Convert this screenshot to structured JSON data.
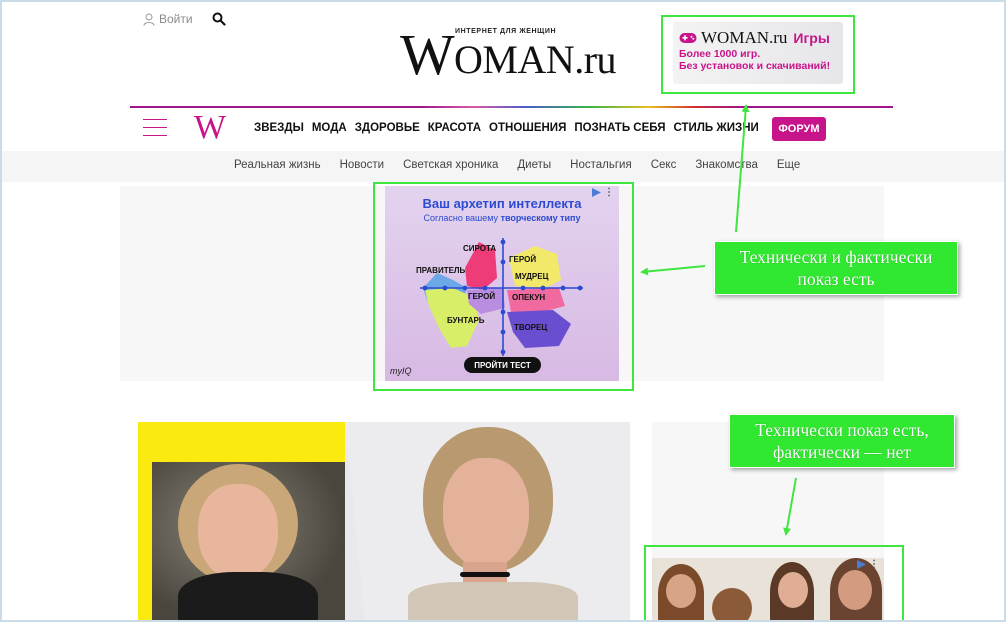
{
  "header": {
    "login_label": "Войти",
    "logo_tagline": "ИНТЕРНЕТ ДЛЯ ЖЕНЩИН",
    "logo_letter": "W",
    "logo_rest": "OMAN.ru"
  },
  "games_banner": {
    "brand": "WOMAN.ru",
    "title": "Игры",
    "line1": "Более 1000 игр.",
    "line2": "Без установок и скачиваний!"
  },
  "nav": {
    "w_mark": "W",
    "items": [
      "ЗВЕЗДЫ",
      "МОДА",
      "ЗДОРОВЬЕ",
      "КРАСОТА",
      "ОТНОШЕНИЯ",
      "ПОЗНАТЬ СЕБЯ",
      "СТИЛЬ ЖИЗНИ"
    ],
    "forum": "ФОРУМ"
  },
  "subnav": {
    "items": [
      "Реальная жизнь",
      "Новости",
      "Светская хроника",
      "Диеты",
      "Ностальгия",
      "Секс",
      "Знакомства",
      "Еще"
    ]
  },
  "archetype_ad": {
    "title": "Ваш архетип интеллекта",
    "subtitle_pre": "Согласно вашему ",
    "subtitle_bold": "творческому типу",
    "labels": {
      "sirota": "СИРОТА",
      "geroy_top": "ГЕРОЙ",
      "pravitel": "ПРАВИТЕЛЬ",
      "mudrets": "МУДРЕЦ",
      "geroy": "ГЕРОЙ",
      "opekun": "ОПЕКУН",
      "buntar": "БУНТАРЬ",
      "tvorets": "ТВОРЕЦ"
    },
    "brand": "myIQ",
    "cta": "ПРОЙТИ ТЕСТ"
  },
  "annotations": {
    "first_line1": "Технически и фактически",
    "first_line2": "показ есть",
    "second_line1": "Технически показ есть,",
    "second_line2": "фактически — нет"
  },
  "colors": {
    "brand": "#c8148a",
    "highlight": "#40e640",
    "annotation": "#30e830"
  }
}
